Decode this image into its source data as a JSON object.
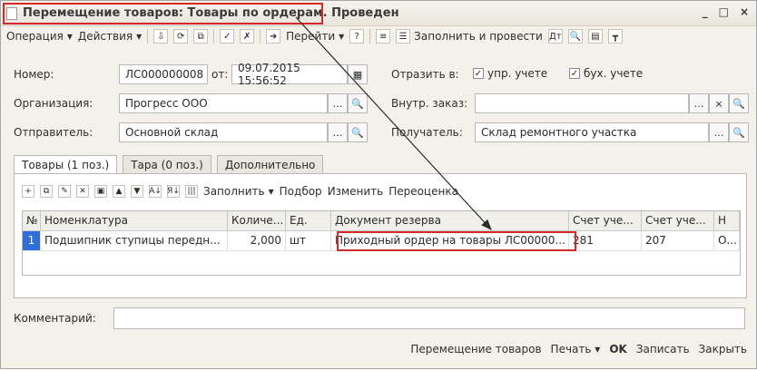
{
  "window": {
    "title_main": "Перемещение товаров: Товары по ордерам.",
    "title_status": "Проведен",
    "controls": [
      "_",
      "□",
      "×"
    ]
  },
  "toolbar": {
    "operation": "Операция",
    "actions": "Действия",
    "go": "Перейти",
    "fill_post": "Заполнить и провести"
  },
  "form": {
    "number_label": "Номер:",
    "number_value": "ЛС000000008",
    "from_label": "от:",
    "date_value": "09.07.2015 15:56:52",
    "reflect_label": "Отразить в:",
    "check_upr": "упр. учете",
    "check_buh": "бух. учете",
    "org_label": "Организация:",
    "org_value": "Прогресс ООО",
    "internal_order_label": "Внутр. заказ:",
    "internal_order_value": "",
    "sender_label": "Отправитель:",
    "sender_value": "Основной склад",
    "receiver_label": "Получатель:",
    "receiver_value": "Склад ремонтного участка"
  },
  "tabs": [
    {
      "label": "Товары (1 поз.)"
    },
    {
      "label": "Тара (0 поз.)"
    },
    {
      "label": "Дополнительно"
    }
  ],
  "subtoolbar": {
    "fill": "Заполнить",
    "select": "Подбор",
    "change": "Изменить",
    "reval": "Переоценка"
  },
  "table": {
    "headers": [
      "№",
      "Номенклатура",
      "Количе...",
      "Ед.",
      "Документ резерва",
      "Счет уче...",
      "Счет уче...",
      "Н"
    ],
    "row": [
      "1",
      "Подшипник ступицы передн...",
      "2,000",
      "шт",
      "Приходный ордер на товары ЛС00000...",
      "281",
      "207",
      "О..."
    ]
  },
  "comment": {
    "label": "Комментарий:",
    "value": ""
  },
  "bottom": {
    "move": "Перемещение товаров",
    "print": "Печать",
    "ok": "OK",
    "save": "Записать",
    "close": "Закрыть"
  }
}
